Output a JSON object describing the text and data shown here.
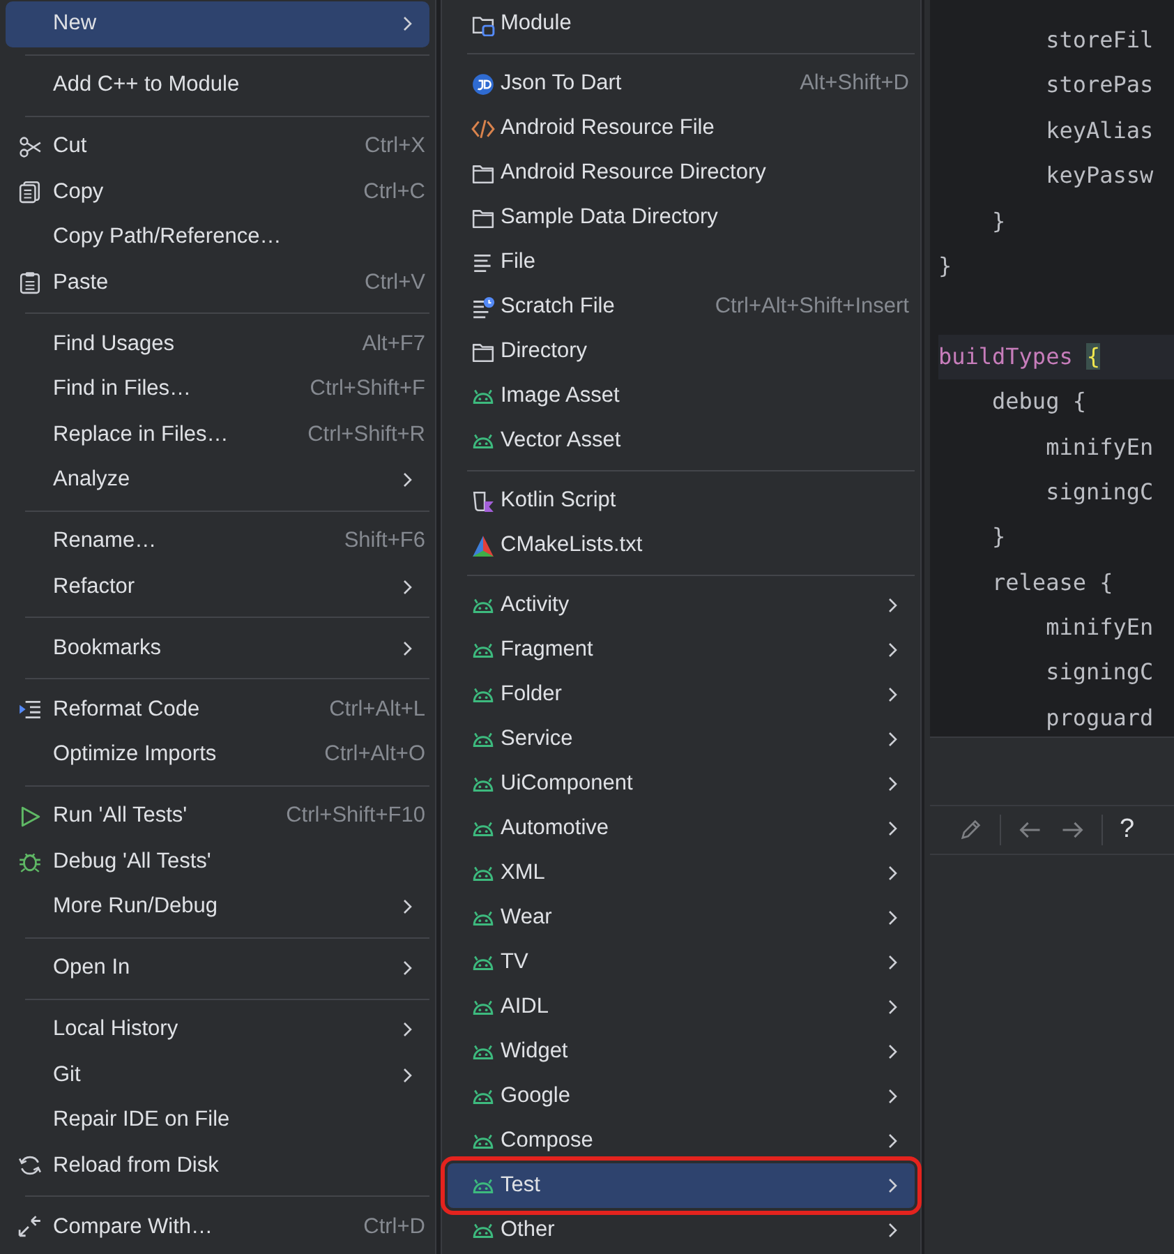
{
  "context_menu": {
    "items": [
      {
        "kind": "submenu",
        "label": "New",
        "selected": true
      },
      {
        "kind": "separator"
      },
      {
        "kind": "action",
        "label": "Add C++ to Module",
        "selected": false
      },
      {
        "kind": "separator"
      },
      {
        "kind": "action",
        "label": "Cut",
        "shortcut": "Ctrl+X",
        "selected": false
      },
      {
        "kind": "action",
        "label": "Copy",
        "shortcut": "Ctrl+C",
        "selected": false
      },
      {
        "kind": "action",
        "label": "Copy Path/Reference…",
        "selected": false
      },
      {
        "kind": "action",
        "label": "Paste",
        "shortcut": "Ctrl+V",
        "selected": false
      },
      {
        "kind": "separator"
      },
      {
        "kind": "action",
        "label": "Find Usages",
        "shortcut": "Alt+F7",
        "selected": false
      },
      {
        "kind": "action",
        "label": "Find in Files…",
        "shortcut": "Ctrl+Shift+F",
        "selected": false
      },
      {
        "kind": "action",
        "label": "Replace in Files…",
        "shortcut": "Ctrl+Shift+R",
        "selected": false
      },
      {
        "kind": "submenu",
        "label": "Analyze",
        "selected": false
      },
      {
        "kind": "separator"
      },
      {
        "kind": "action",
        "label": "Rename…",
        "shortcut": "Shift+F6",
        "selected": false
      },
      {
        "kind": "submenu",
        "label": "Refactor",
        "selected": false
      },
      {
        "kind": "separator"
      },
      {
        "kind": "submenu",
        "label": "Bookmarks",
        "selected": false
      },
      {
        "kind": "separator"
      },
      {
        "kind": "action",
        "label": "Reformat Code",
        "shortcut": "Ctrl+Alt+L",
        "selected": false
      },
      {
        "kind": "action",
        "label": "Optimize Imports",
        "shortcut": "Ctrl+Alt+O",
        "selected": false
      },
      {
        "kind": "separator"
      },
      {
        "kind": "action",
        "label": "Run 'All Tests'",
        "shortcut": "Ctrl+Shift+F10",
        "selected": false
      },
      {
        "kind": "action",
        "label": "Debug 'All Tests'",
        "selected": false
      },
      {
        "kind": "submenu",
        "label": "More Run/Debug",
        "selected": false
      },
      {
        "kind": "separator"
      },
      {
        "kind": "submenu",
        "label": "Open In",
        "selected": false
      },
      {
        "kind": "separator"
      },
      {
        "kind": "submenu",
        "label": "Local History",
        "selected": false
      },
      {
        "kind": "submenu",
        "label": "Git",
        "selected": false
      },
      {
        "kind": "action",
        "label": "Repair IDE on File",
        "selected": false
      },
      {
        "kind": "action",
        "label": "Reload from Disk",
        "selected": false
      },
      {
        "kind": "separator"
      },
      {
        "kind": "action",
        "label": "Compare With…",
        "shortcut": "Ctrl+D",
        "selected": false
      }
    ]
  },
  "new_submenu": {
    "items": [
      {
        "kind": "action",
        "label": "Module",
        "selected": false,
        "highlighted": false
      },
      {
        "kind": "separator"
      },
      {
        "kind": "action",
        "label": "Json To Dart",
        "shortcut": "Alt+Shift+D",
        "selected": false,
        "highlighted": false
      },
      {
        "kind": "action",
        "label": "Android Resource File",
        "selected": false,
        "highlighted": false
      },
      {
        "kind": "action",
        "label": "Android Resource Directory",
        "selected": false,
        "highlighted": false
      },
      {
        "kind": "action",
        "label": "Sample Data Directory",
        "selected": false,
        "highlighted": false
      },
      {
        "kind": "action",
        "label": "File",
        "selected": false,
        "highlighted": false
      },
      {
        "kind": "action",
        "label": "Scratch File",
        "shortcut": "Ctrl+Alt+Shift+Insert",
        "selected": false,
        "highlighted": false
      },
      {
        "kind": "action",
        "label": "Directory",
        "selected": false,
        "highlighted": false
      },
      {
        "kind": "action",
        "label": "Image Asset",
        "selected": false,
        "highlighted": false
      },
      {
        "kind": "action",
        "label": "Vector Asset",
        "selected": false,
        "highlighted": false
      },
      {
        "kind": "separator"
      },
      {
        "kind": "action",
        "label": "Kotlin Script",
        "selected": false,
        "highlighted": false
      },
      {
        "kind": "action",
        "label": "CMakeLists.txt",
        "selected": false,
        "highlighted": false
      },
      {
        "kind": "separator"
      },
      {
        "kind": "submenu",
        "label": "Activity",
        "selected": false,
        "highlighted": false
      },
      {
        "kind": "submenu",
        "label": "Fragment",
        "selected": false,
        "highlighted": false
      },
      {
        "kind": "submenu",
        "label": "Folder",
        "selected": false,
        "highlighted": false
      },
      {
        "kind": "submenu",
        "label": "Service",
        "selected": false,
        "highlighted": false
      },
      {
        "kind": "submenu",
        "label": "UiComponent",
        "selected": false,
        "highlighted": false
      },
      {
        "kind": "submenu",
        "label": "Automotive",
        "selected": false,
        "highlighted": false
      },
      {
        "kind": "submenu",
        "label": "XML",
        "selected": false,
        "highlighted": false
      },
      {
        "kind": "submenu",
        "label": "Wear",
        "selected": false,
        "highlighted": false
      },
      {
        "kind": "submenu",
        "label": "TV",
        "selected": false,
        "highlighted": false
      },
      {
        "kind": "submenu",
        "label": "AIDL",
        "selected": false,
        "highlighted": false
      },
      {
        "kind": "submenu",
        "label": "Widget",
        "selected": false,
        "highlighted": false
      },
      {
        "kind": "submenu",
        "label": "Google",
        "selected": false,
        "highlighted": false
      },
      {
        "kind": "submenu",
        "label": "Compose",
        "selected": false,
        "highlighted": false
      },
      {
        "kind": "submenu",
        "label": "Test",
        "selected": true,
        "highlighted": true
      },
      {
        "kind": "submenu",
        "label": "Other",
        "selected": false,
        "highlighted": false
      }
    ]
  },
  "editor": {
    "lines": [
      {
        "kind": "code",
        "current": false,
        "tokens": [
          {
            "kind": "plain",
            "text": "        storeFil"
          }
        ]
      },
      {
        "kind": "code",
        "current": false,
        "tokens": [
          {
            "kind": "plain",
            "text": "        storePas"
          }
        ]
      },
      {
        "kind": "code",
        "current": false,
        "tokens": [
          {
            "kind": "plain",
            "text": "        keyAlias"
          }
        ]
      },
      {
        "kind": "code",
        "current": false,
        "tokens": [
          {
            "kind": "plain",
            "text": "        keyPassw"
          }
        ]
      },
      {
        "kind": "code",
        "current": false,
        "tokens": [
          {
            "kind": "plain",
            "text": "    }"
          }
        ]
      },
      {
        "kind": "code",
        "current": false,
        "tokens": [
          {
            "kind": "plain",
            "text": "}"
          }
        ]
      },
      {
        "kind": "blank"
      },
      {
        "kind": "code",
        "current": true,
        "tokens": [
          {
            "kind": "member",
            "text": "buildTypes"
          },
          {
            "kind": "matched_brace",
            "text": "{"
          }
        ]
      },
      {
        "kind": "code",
        "current": false,
        "tokens": [
          {
            "kind": "plain",
            "text": "    debug {"
          }
        ]
      },
      {
        "kind": "code",
        "current": false,
        "tokens": [
          {
            "kind": "plain",
            "text": "        minifyEn"
          }
        ]
      },
      {
        "kind": "code",
        "current": false,
        "tokens": [
          {
            "kind": "plain",
            "text": "        signingC"
          }
        ]
      },
      {
        "kind": "code",
        "current": false,
        "tokens": [
          {
            "kind": "plain",
            "text": "    }"
          }
        ]
      },
      {
        "kind": "code",
        "current": false,
        "tokens": [
          {
            "kind": "plain",
            "text": "    release {"
          }
        ]
      },
      {
        "kind": "code",
        "current": false,
        "tokens": [
          {
            "kind": "plain",
            "text": "        minifyEn"
          }
        ]
      },
      {
        "kind": "code",
        "current": false,
        "tokens": [
          {
            "kind": "plain",
            "text": "        signingC"
          }
        ]
      },
      {
        "kind": "code",
        "current": false,
        "tokens": [
          {
            "kind": "plain",
            "text": "        proguard"
          }
        ]
      }
    ]
  },
  "toolbar": {
    "buttons": [
      {
        "kind": "edit",
        "disabled": true
      },
      {
        "kind": "separator"
      },
      {
        "kind": "back",
        "disabled": true
      },
      {
        "kind": "forward",
        "disabled": true
      },
      {
        "kind": "separator"
      },
      {
        "kind": "help",
        "label": "?",
        "disabled": false
      }
    ]
  }
}
